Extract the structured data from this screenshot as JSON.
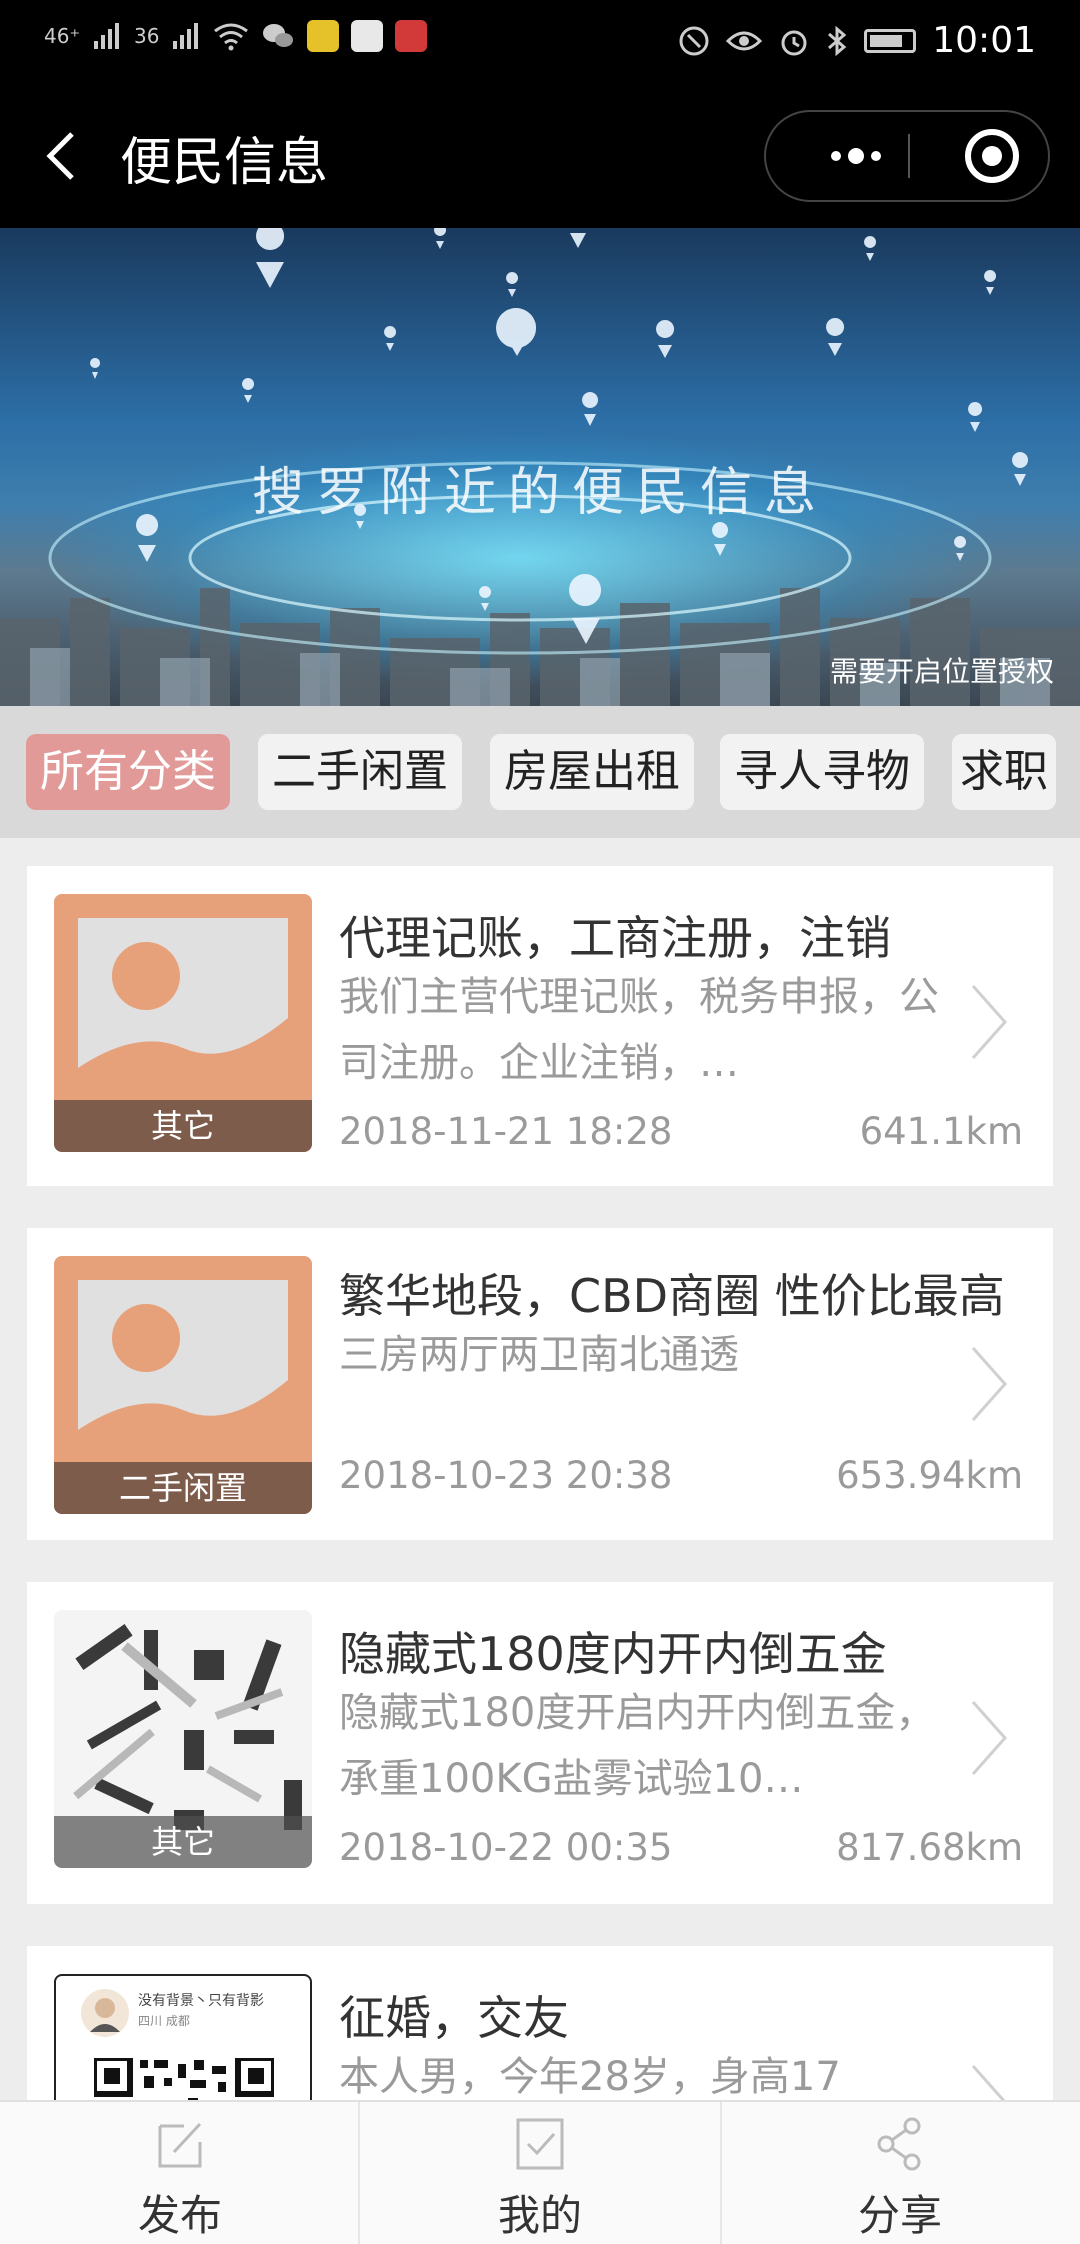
{
  "status_bar": {
    "signal_1": "46⁺",
    "signal_2": "36",
    "time": "10:01",
    "icons": [
      "signal-icon",
      "wifi-icon",
      "wechat-icon",
      "app-icon-yellow",
      "app-icon-map",
      "app-icon-red",
      "nfc-icon",
      "eye-icon",
      "alarm-icon",
      "bluetooth-icon",
      "battery-icon"
    ]
  },
  "navbar": {
    "title": "便民信息",
    "more_icon": "more-dots-icon",
    "close_icon": "target-close-icon"
  },
  "banner": {
    "title": "搜罗附近的便民信息",
    "note": "需要开启位置授权"
  },
  "tabs": [
    {
      "label": "所有分类",
      "active": true
    },
    {
      "label": "二手闲置",
      "active": false
    },
    {
      "label": "房屋出租",
      "active": false
    },
    {
      "label": "寻人寻物",
      "active": false
    },
    {
      "label": "求职",
      "active": false
    }
  ],
  "colors": {
    "active_tab": "#e29a98",
    "placeholder_orange": "#e6a07a",
    "text_gray": "#9a9a9a"
  },
  "items": [
    {
      "title": "代理记账，工商注册，注销",
      "description": "我们主营代理记账，税务申报，公司注册。企业注销，…",
      "category": "其它",
      "date": "2018-11-21 18:28",
      "distance": "641.1km"
    },
    {
      "title": "繁华地段，CBD商圈 性价比最高",
      "description": "三房两厅两卫南北通透",
      "category": "二手闲置",
      "date": "2018-10-23 20:38",
      "distance": "653.94km"
    },
    {
      "title": "隐藏式180度内开内倒五金",
      "description": "隐藏式180度开启内开内倒五金，承重100KG盐雾试验10…",
      "category": "其它",
      "date": "2018-10-22 00:35",
      "distance": "817.68km"
    },
    {
      "title": "征婚，交友",
      "description": "本人男，今年28岁，身高17",
      "qr_caption_1": "没有背景丶只有背影",
      "qr_caption_2": "四川 成都"
    }
  ],
  "bottom_bar": [
    {
      "label": "发布",
      "icon": "edit-icon"
    },
    {
      "label": "我的",
      "icon": "checklist-icon"
    },
    {
      "label": "分享",
      "icon": "share-icon"
    }
  ]
}
